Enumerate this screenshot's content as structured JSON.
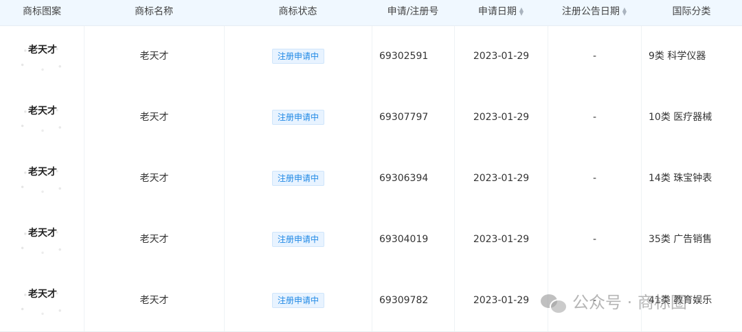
{
  "headers": {
    "logo": "商标图案",
    "name": "商标名称",
    "status": "商标状态",
    "reg_no": "申请/注册号",
    "apply_date": "申请日期",
    "announce_date": "注册公告日期",
    "class": "国际分类"
  },
  "sort_icon": "sort-updown-icon",
  "rows": [
    {
      "logo_text": "老天才",
      "name": "老天才",
      "status": "注册申请中",
      "reg_no": "69302591",
      "apply_date": "2023-01-29",
      "announce_date": "-",
      "class": "9类 科学仪器"
    },
    {
      "logo_text": "老天才",
      "name": "老天才",
      "status": "注册申请中",
      "reg_no": "69307797",
      "apply_date": "2023-01-29",
      "announce_date": "-",
      "class": "10类 医疗器械"
    },
    {
      "logo_text": "老天才",
      "name": "老天才",
      "status": "注册申请中",
      "reg_no": "69306394",
      "apply_date": "2023-01-29",
      "announce_date": "-",
      "class": "14类 珠宝钟表"
    },
    {
      "logo_text": "老天才",
      "name": "老天才",
      "status": "注册申请中",
      "reg_no": "69304019",
      "apply_date": "2023-01-29",
      "announce_date": "-",
      "class": "35类 广告销售"
    },
    {
      "logo_text": "老天才",
      "name": "老天才",
      "status": "注册申请中",
      "reg_no": "69309782",
      "apply_date": "2023-01-29",
      "announce_date": "-",
      "class": "41类 教育娱乐"
    }
  ],
  "watermark": {
    "text": "公众号 · 商标圈",
    "icon": "wechat-icon"
  },
  "colors": {
    "header_bg": "#f0f8ff",
    "badge_text": "#1e88e5",
    "badge_bg": "#e8f3ff"
  }
}
